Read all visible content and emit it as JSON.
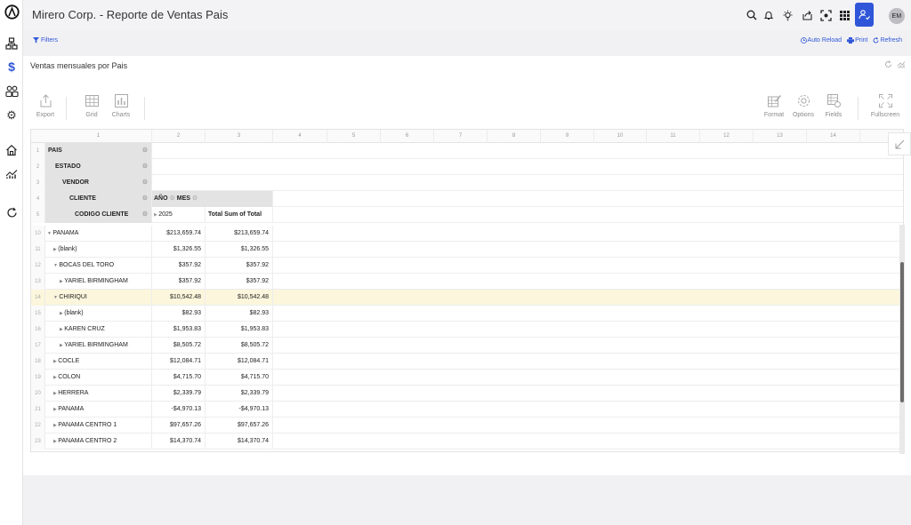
{
  "app": {
    "title": "Mirero Corp. - Reporte de Ventas Pais",
    "user_initials": "EM"
  },
  "filterbar": {
    "filters_label": "Filters",
    "auto_reload_label": "Auto Reload",
    "print_label": "Print",
    "refresh_label": "Refresh"
  },
  "panel": {
    "title": "Ventas mensuales por Pais"
  },
  "toolbar": {
    "export_label": "Export",
    "grid_label": "Grid",
    "charts_label": "Charts",
    "format_label": "Format",
    "options_label": "Options",
    "fields_label": "Fields",
    "fullscreen_label": "Fullscreen"
  },
  "grid": {
    "column_headers": [
      "1",
      "2",
      "3",
      "4",
      "5",
      "6",
      "7",
      "8",
      "9",
      "10",
      "11",
      "12",
      "13",
      "14"
    ],
    "header_rows": [
      {
        "num": "1",
        "label": "PAIS"
      },
      {
        "num": "2",
        "label": "ESTADO"
      },
      {
        "num": "3",
        "label": "VENDOR"
      },
      {
        "num": "4",
        "label": "CLIENTE",
        "col_fields": [
          "AÑO",
          "MES"
        ]
      },
      {
        "num": "5",
        "label": "CODIGO CLIENTE",
        "year": "2025",
        "total_label": "Total Sum of Total"
      }
    ],
    "rows": [
      {
        "num": "10",
        "label": "PANAMA",
        "arrow": "▼",
        "indent": 0,
        "v1": "$213,659.74",
        "v2": "$213,659.74"
      },
      {
        "num": "11",
        "label": "(blank)",
        "arrow": "▶",
        "indent": 1,
        "v1": "$1,326.55",
        "v2": "$1,326.55"
      },
      {
        "num": "12",
        "label": "BOCAS DEL TORO",
        "arrow": "▼",
        "indent": 1,
        "v1": "$357.92",
        "v2": "$357.92"
      },
      {
        "num": "13",
        "label": "YARIEL BIRMINGHAM",
        "arrow": "▶",
        "indent": 2,
        "v1": "$357.92",
        "v2": "$357.92"
      },
      {
        "num": "14",
        "label": "CHIRIQUI",
        "arrow": "▼",
        "indent": 1,
        "v1": "$10,542.48",
        "v2": "$10,542.48",
        "highlight": true
      },
      {
        "num": "15",
        "label": "(blank)",
        "arrow": "▶",
        "indent": 2,
        "v1": "$82.93",
        "v2": "$82.93"
      },
      {
        "num": "16",
        "label": "KAREN CRUZ",
        "arrow": "▶",
        "indent": 2,
        "v1": "$1,953.83",
        "v2": "$1,953.83"
      },
      {
        "num": "17",
        "label": "YARIEL BIRMINGHAM",
        "arrow": "▶",
        "indent": 2,
        "v1": "$8,505.72",
        "v2": "$8,505.72"
      },
      {
        "num": "18",
        "label": "COCLE",
        "arrow": "▶",
        "indent": 1,
        "v1": "$12,084.71",
        "v2": "$12,084.71"
      },
      {
        "num": "19",
        "label": "COLON",
        "arrow": "▶",
        "indent": 1,
        "v1": "$4,715.70",
        "v2": "$4,715.70"
      },
      {
        "num": "20",
        "label": "HERRERA",
        "arrow": "▶",
        "indent": 1,
        "v1": "$2,339.79",
        "v2": "$2,339.79"
      },
      {
        "num": "21",
        "label": "PANAMA",
        "arrow": "▶",
        "indent": 1,
        "v1": "-$4,970.13",
        "v2": "-$4,970.13"
      },
      {
        "num": "22",
        "label": "PANAMA CENTRO 1",
        "arrow": "▶",
        "indent": 1,
        "v1": "$97,657.26",
        "v2": "$97,657.26"
      },
      {
        "num": "23",
        "label": "PANAMA CENTRO 2",
        "arrow": "▶",
        "indent": 1,
        "v1": "$14,370.74",
        "v2": "$14,370.74"
      }
    ]
  },
  "colors": {
    "accent": "#2f56d8",
    "highlight_row": "#fbf6dc",
    "field_header": "#e3e3e3"
  }
}
